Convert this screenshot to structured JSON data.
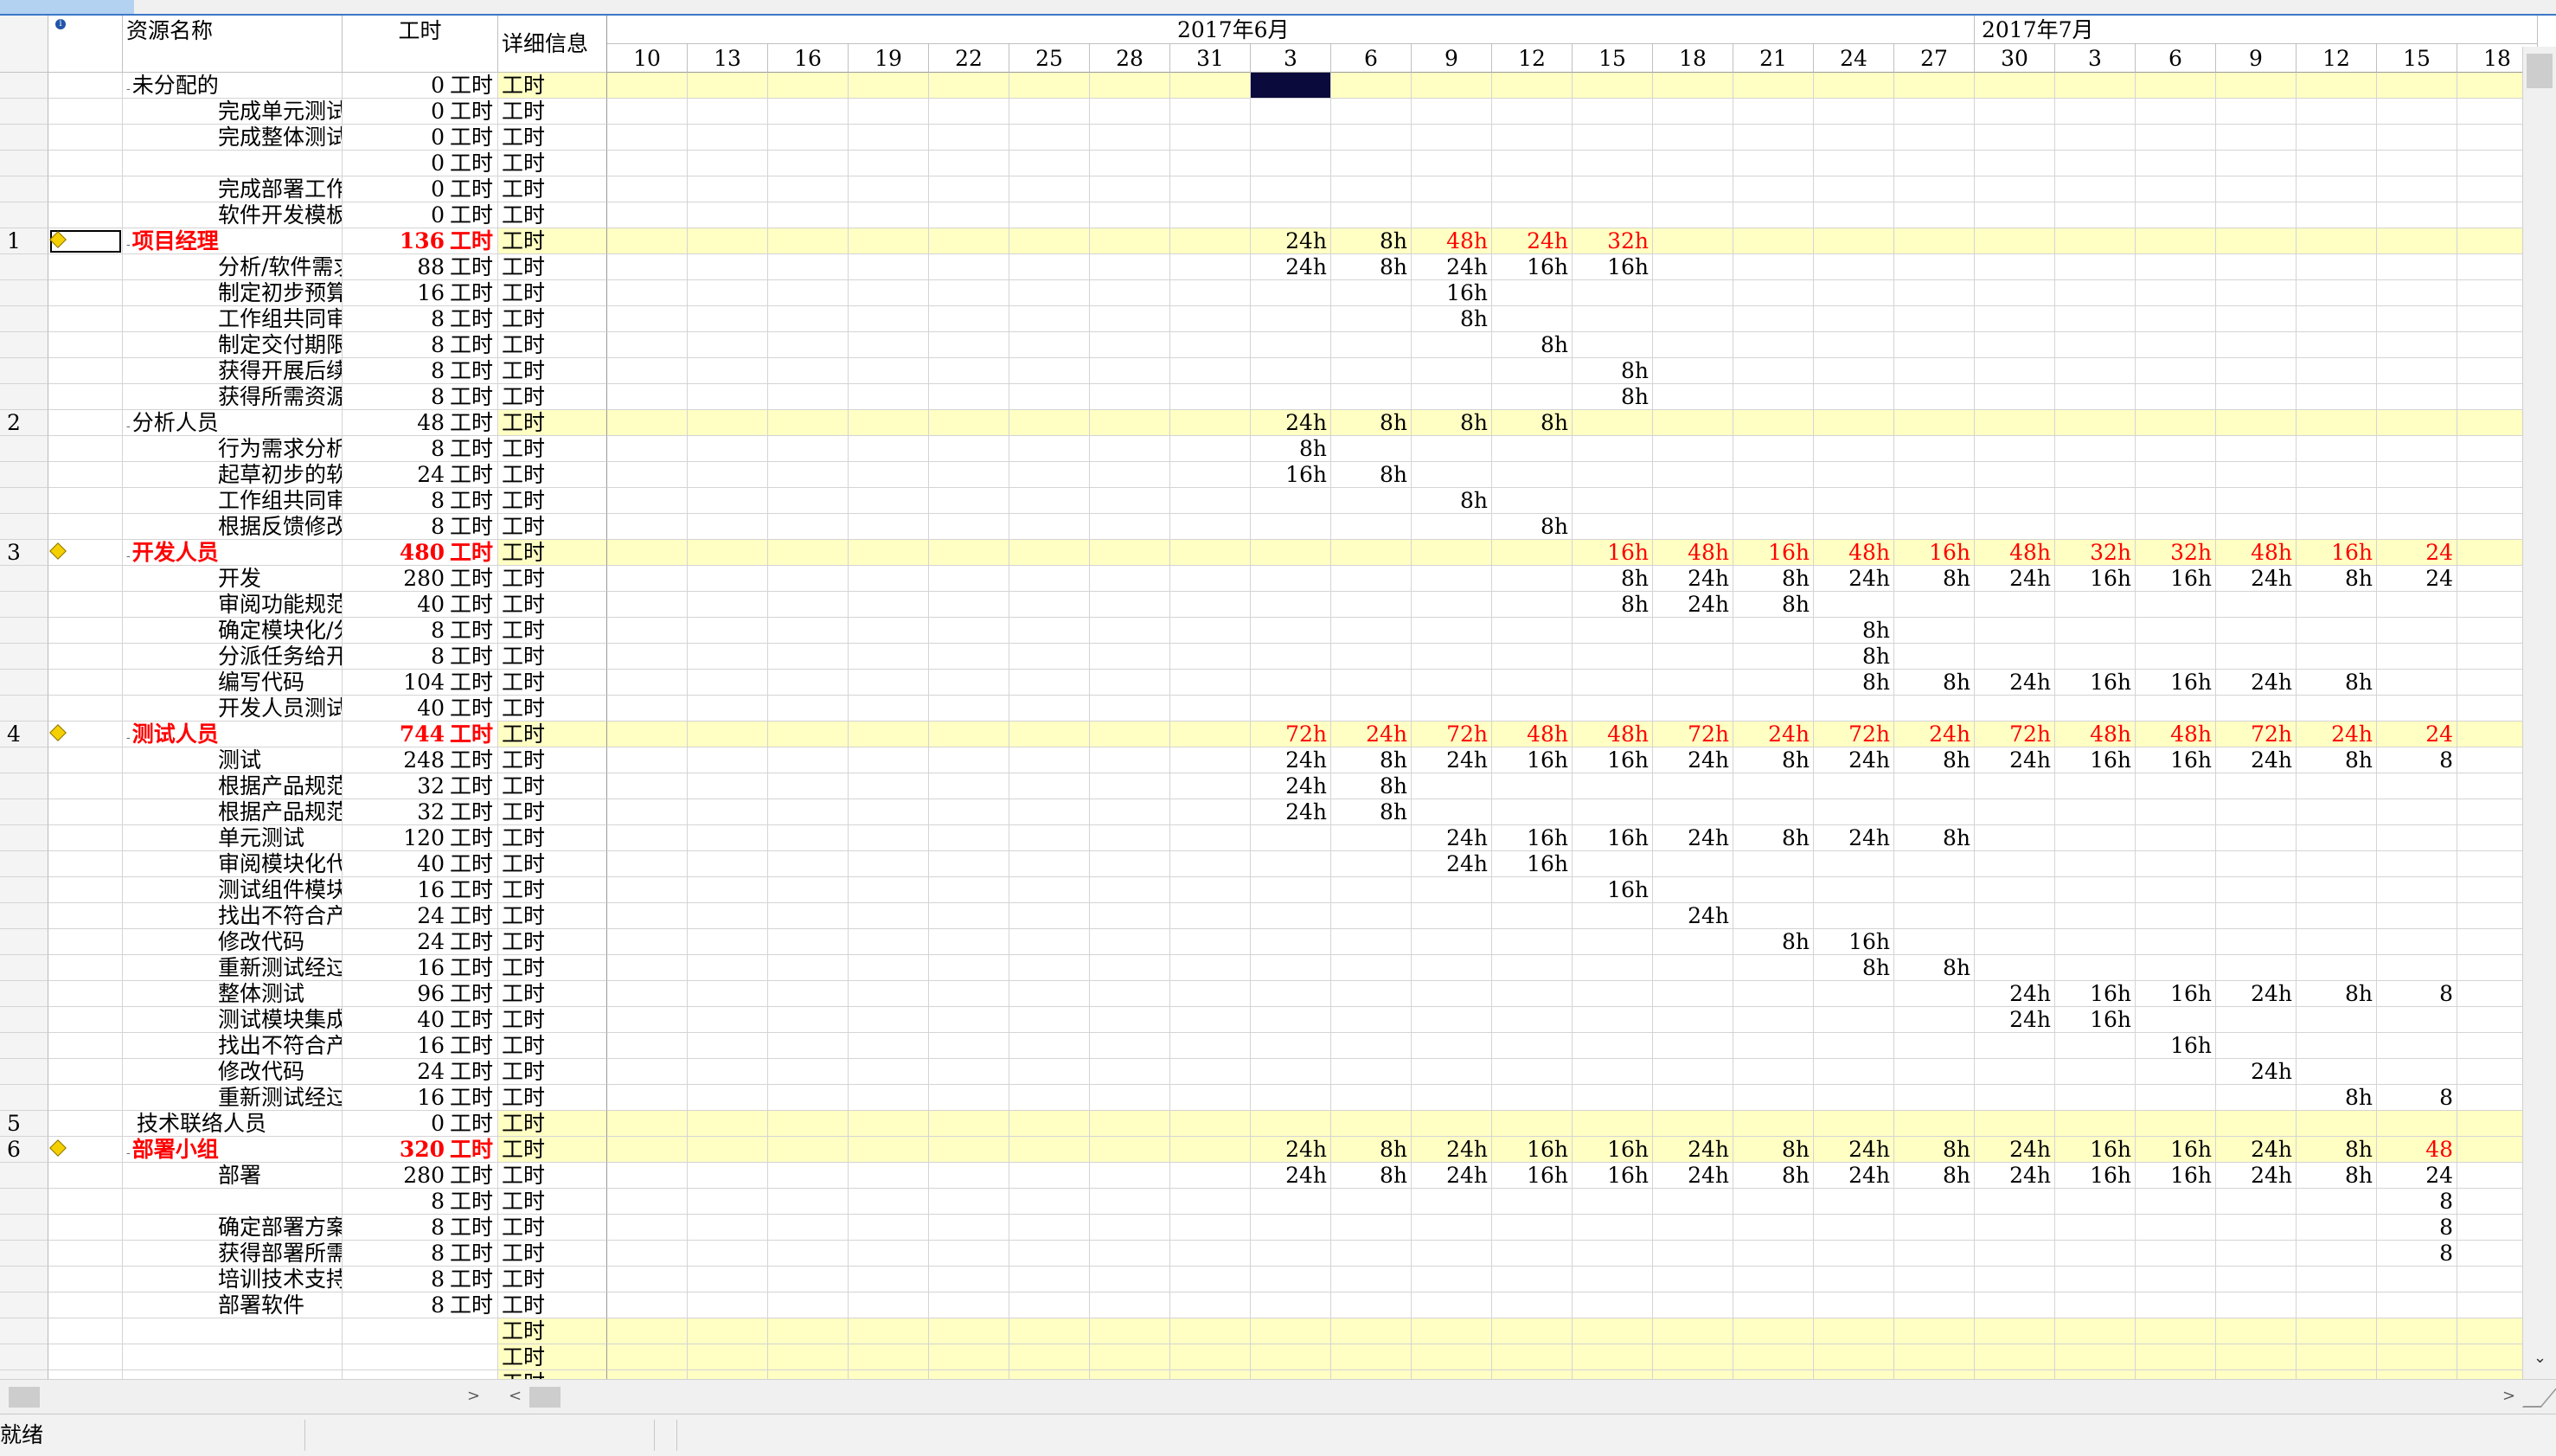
{
  "header": {
    "col_name": "资源名称",
    "col_work": "工时",
    "col_detail": "详细信息",
    "indicator_icon": "info-icon",
    "months": [
      "2017年6月",
      "2017年7月"
    ],
    "days": [
      "10",
      "13",
      "16",
      "19",
      "22",
      "25",
      "28",
      "31",
      "3",
      "6",
      "9",
      "12",
      "15",
      "18",
      "21",
      "24",
      "27",
      "30",
      "3",
      "6",
      "9",
      "12",
      "15",
      "18"
    ]
  },
  "unit": "工时",
  "rows": [
    {
      "id": "",
      "name": "未分配的",
      "level": 0,
      "work": "0",
      "summary": true,
      "over": false,
      "cells": {}
    },
    {
      "id": "",
      "name": "完成单元测试",
      "level": 1,
      "work": "0",
      "cells": {}
    },
    {
      "id": "",
      "name": "完成整体测试",
      "level": 1,
      "work": "0",
      "cells": {}
    },
    {
      "id": "",
      "name": "",
      "level": 1,
      "work": "0",
      "cells": {}
    },
    {
      "id": "",
      "name": "完成部署工作",
      "level": 1,
      "work": "0",
      "cells": {}
    },
    {
      "id": "",
      "name": "软件开发模板",
      "level": 1,
      "work": "0",
      "cells": {}
    },
    {
      "id": "1",
      "name": "项目经理",
      "level": 0,
      "work": "136",
      "summary": true,
      "over": true,
      "cells": {
        "9": "24h",
        "10": "8h",
        "11": "48h",
        "12": "24h",
        "13": "32h"
      },
      "redcells": [
        11,
        12,
        13
      ]
    },
    {
      "id": "",
      "name": "分析/软件需求",
      "level": 1,
      "work": "88",
      "cells": {
        "9": "24h",
        "10": "8h",
        "11": "24h",
        "12": "16h",
        "13": "16h"
      }
    },
    {
      "id": "",
      "name": "制定初步预算",
      "level": 1,
      "work": "16",
      "cells": {
        "11": "16h"
      }
    },
    {
      "id": "",
      "name": "工作组共同审阅",
      "level": 1,
      "work": "8",
      "cells": {
        "11": "8h"
      }
    },
    {
      "id": "",
      "name": "制定交付期限",
      "level": 1,
      "work": "8",
      "cells": {
        "12": "8h"
      }
    },
    {
      "id": "",
      "name": "获得开展后续工作",
      "level": 1,
      "work": "8",
      "cells": {
        "13": "8h"
      }
    },
    {
      "id": "",
      "name": "获得所需资源",
      "level": 1,
      "work": "8",
      "cells": {
        "13": "8h"
      }
    },
    {
      "id": "2",
      "name": "分析人员",
      "level": 0,
      "work": "48",
      "summary": true,
      "over": false,
      "cells": {
        "9": "24h",
        "10": "8h",
        "11": "8h",
        "12": "8h"
      }
    },
    {
      "id": "",
      "name": "行为需求分析",
      "level": 1,
      "work": "8",
      "cells": {
        "9": "8h"
      }
    },
    {
      "id": "",
      "name": "起草初步的软件规范",
      "level": 1,
      "work": "24",
      "cells": {
        "9": "16h",
        "10": "8h"
      }
    },
    {
      "id": "",
      "name": "工作组共同审阅",
      "level": 1,
      "work": "8",
      "cells": {
        "11": "8h"
      }
    },
    {
      "id": "",
      "name": "根据反馈修改",
      "level": 1,
      "work": "8",
      "cells": {
        "12": "8h"
      }
    },
    {
      "id": "3",
      "name": "开发人员",
      "level": 0,
      "work": "480",
      "summary": true,
      "over": true,
      "cells": {
        "13": "16h",
        "14": "48h",
        "15": "16h",
        "16": "48h",
        "17": "16h",
        "18": "48h",
        "19": "32h",
        "20": "32h",
        "21": "48h",
        "22": "16h",
        "23": "24"
      },
      "redcells": [
        13,
        14,
        15,
        16,
        17,
        18,
        19,
        20,
        21,
        22,
        23
      ]
    },
    {
      "id": "",
      "name": "开发",
      "level": 1,
      "work": "280",
      "cells": {
        "13": "8h",
        "14": "24h",
        "15": "8h",
        "16": "24h",
        "17": "8h",
        "18": "24h",
        "19": "16h",
        "20": "16h",
        "21": "24h",
        "22": "8h",
        "23": "24"
      }
    },
    {
      "id": "",
      "name": "审阅功能规范",
      "level": 1,
      "work": "40",
      "cells": {
        "13": "8h",
        "14": "24h",
        "15": "8h"
      }
    },
    {
      "id": "",
      "name": "确定模块化/分层",
      "level": 1,
      "work": "8",
      "cells": {
        "16": "8h"
      }
    },
    {
      "id": "",
      "name": "分派任务给开发",
      "level": 1,
      "work": "8",
      "cells": {
        "16": "8h"
      }
    },
    {
      "id": "",
      "name": "编写代码",
      "level": 1,
      "work": "104",
      "cells": {
        "16": "8h",
        "17": "8h",
        "18": "24h",
        "19": "16h",
        "20": "16h",
        "21": "24h",
        "22": "8h"
      }
    },
    {
      "id": "",
      "name": "开发人员测试",
      "level": 1,
      "work": "40",
      "cells": {}
    },
    {
      "id": "4",
      "name": "测试人员",
      "level": 0,
      "work": "744",
      "summary": true,
      "over": true,
      "cells": {
        "9": "72h",
        "10": "24h",
        "11": "72h",
        "12": "48h",
        "13": "48h",
        "14": "72h",
        "15": "24h",
        "16": "72h",
        "17": "24h",
        "18": "72h",
        "19": "48h",
        "20": "48h",
        "21": "72h",
        "22": "24h",
        "23": "24"
      },
      "redcells": [
        9,
        10,
        11,
        12,
        13,
        14,
        15,
        16,
        17,
        18,
        19,
        20,
        21,
        22,
        23
      ]
    },
    {
      "id": "",
      "name": "测试",
      "level": 1,
      "work": "248",
      "cells": {
        "9": "24h",
        "10": "8h",
        "11": "24h",
        "12": "16h",
        "13": "16h",
        "14": "24h",
        "15": "8h",
        "16": "24h",
        "17": "8h",
        "18": "24h",
        "19": "16h",
        "20": "16h",
        "21": "24h",
        "22": "8h",
        "23": "8"
      }
    },
    {
      "id": "",
      "name": "根据产品规范",
      "level": 1,
      "work": "32",
      "cells": {
        "9": "24h",
        "10": "8h"
      }
    },
    {
      "id": "",
      "name": "根据产品规范",
      "level": 1,
      "work": "32",
      "cells": {
        "9": "24h",
        "10": "8h"
      }
    },
    {
      "id": "",
      "name": "单元测试",
      "level": 1,
      "work": "120",
      "cells": {
        "11": "24h",
        "12": "16h",
        "13": "16h",
        "14": "24h",
        "15": "8h",
        "16": "24h",
        "17": "8h"
      }
    },
    {
      "id": "",
      "name": "审阅模块化代码",
      "level": 1,
      "work": "40",
      "cells": {
        "11": "24h",
        "12": "16h"
      }
    },
    {
      "id": "",
      "name": "测试组件模块",
      "level": 1,
      "work": "16",
      "cells": {
        "13": "16h"
      }
    },
    {
      "id": "",
      "name": "找出不符合产品",
      "level": 1,
      "work": "24",
      "cells": {
        "14": "24h"
      }
    },
    {
      "id": "",
      "name": "修改代码",
      "level": 1,
      "work": "24",
      "cells": {
        "15": "8h",
        "16": "16h"
      }
    },
    {
      "id": "",
      "name": "重新测试经过",
      "level": 1,
      "work": "16",
      "cells": {
        "16": "8h",
        "17": "8h"
      }
    },
    {
      "id": "",
      "name": "整体测试",
      "level": 1,
      "work": "96",
      "cells": {
        "18": "24h",
        "19": "16h",
        "20": "16h",
        "21": "24h",
        "22": "8h",
        "23": "8"
      }
    },
    {
      "id": "",
      "name": "测试模块集成",
      "level": 1,
      "work": "40",
      "cells": {
        "18": "24h",
        "19": "16h"
      }
    },
    {
      "id": "",
      "name": "找出不符合产品",
      "level": 1,
      "work": "16",
      "cells": {
        "20": "16h"
      }
    },
    {
      "id": "",
      "name": "修改代码",
      "level": 1,
      "work": "24",
      "cells": {
        "21": "24h"
      }
    },
    {
      "id": "",
      "name": "重新测试经过",
      "level": 1,
      "work": "16",
      "cells": {
        "22": "8h",
        "23": "8"
      }
    },
    {
      "id": "5",
      "name": "技术联络人员",
      "level": 0,
      "work": "0",
      "summary": true,
      "over": false,
      "nooutline": true,
      "cells": {}
    },
    {
      "id": "6",
      "name": "部署小组",
      "level": 0,
      "work": "320",
      "summary": true,
      "over": true,
      "cells": {
        "9": "24h",
        "10": "8h",
        "11": "24h",
        "12": "16h",
        "13": "16h",
        "14": "24h",
        "15": "8h",
        "16": "24h",
        "17": "8h",
        "18": "24h",
        "19": "16h",
        "20": "16h",
        "21": "24h",
        "22": "8h",
        "23": "48"
      },
      "redcells": [
        23
      ]
    },
    {
      "id": "",
      "name": "部署",
      "level": 1,
      "work": "280",
      "cells": {
        "9": "24h",
        "10": "8h",
        "11": "24h",
        "12": "16h",
        "13": "16h",
        "14": "24h",
        "15": "8h",
        "16": "24h",
        "17": "8h",
        "18": "24h",
        "19": "16h",
        "20": "16h",
        "21": "24h",
        "22": "8h",
        "23": "24"
      }
    },
    {
      "id": "",
      "name": "",
      "level": 1,
      "work": "8",
      "cells": {
        "23": "8"
      }
    },
    {
      "id": "",
      "name": "确定部署方案",
      "level": 1,
      "work": "8",
      "cells": {
        "23": "8"
      }
    },
    {
      "id": "",
      "name": "获得部署所需",
      "level": 1,
      "work": "8",
      "cells": {
        "23": "8"
      }
    },
    {
      "id": "",
      "name": "培训技术支持",
      "level": 1,
      "work": "8",
      "cells": {}
    },
    {
      "id": "",
      "name": "部署软件",
      "level": 1,
      "work": "8",
      "cells": {}
    },
    {
      "id": "",
      "name": "",
      "level": 0,
      "work": "",
      "detail_only": true,
      "summary": true,
      "cells": {}
    },
    {
      "id": "",
      "name": "",
      "level": 0,
      "work": "",
      "detail_only": true,
      "summary": true,
      "cells": {}
    },
    {
      "id": "",
      "name": "",
      "level": 0,
      "work": "",
      "detail_only": true,
      "summary": true,
      "cells": {}
    }
  ],
  "status": {
    "left": "就绪"
  },
  "scroll": {
    "left_arrow": "<",
    "right_arrow": ">",
    "down_arrow": "⌄"
  },
  "colors": {
    "highlight": "#ffffc4",
    "overalloc": "#ff0000",
    "selected": "#0a0a3c"
  }
}
